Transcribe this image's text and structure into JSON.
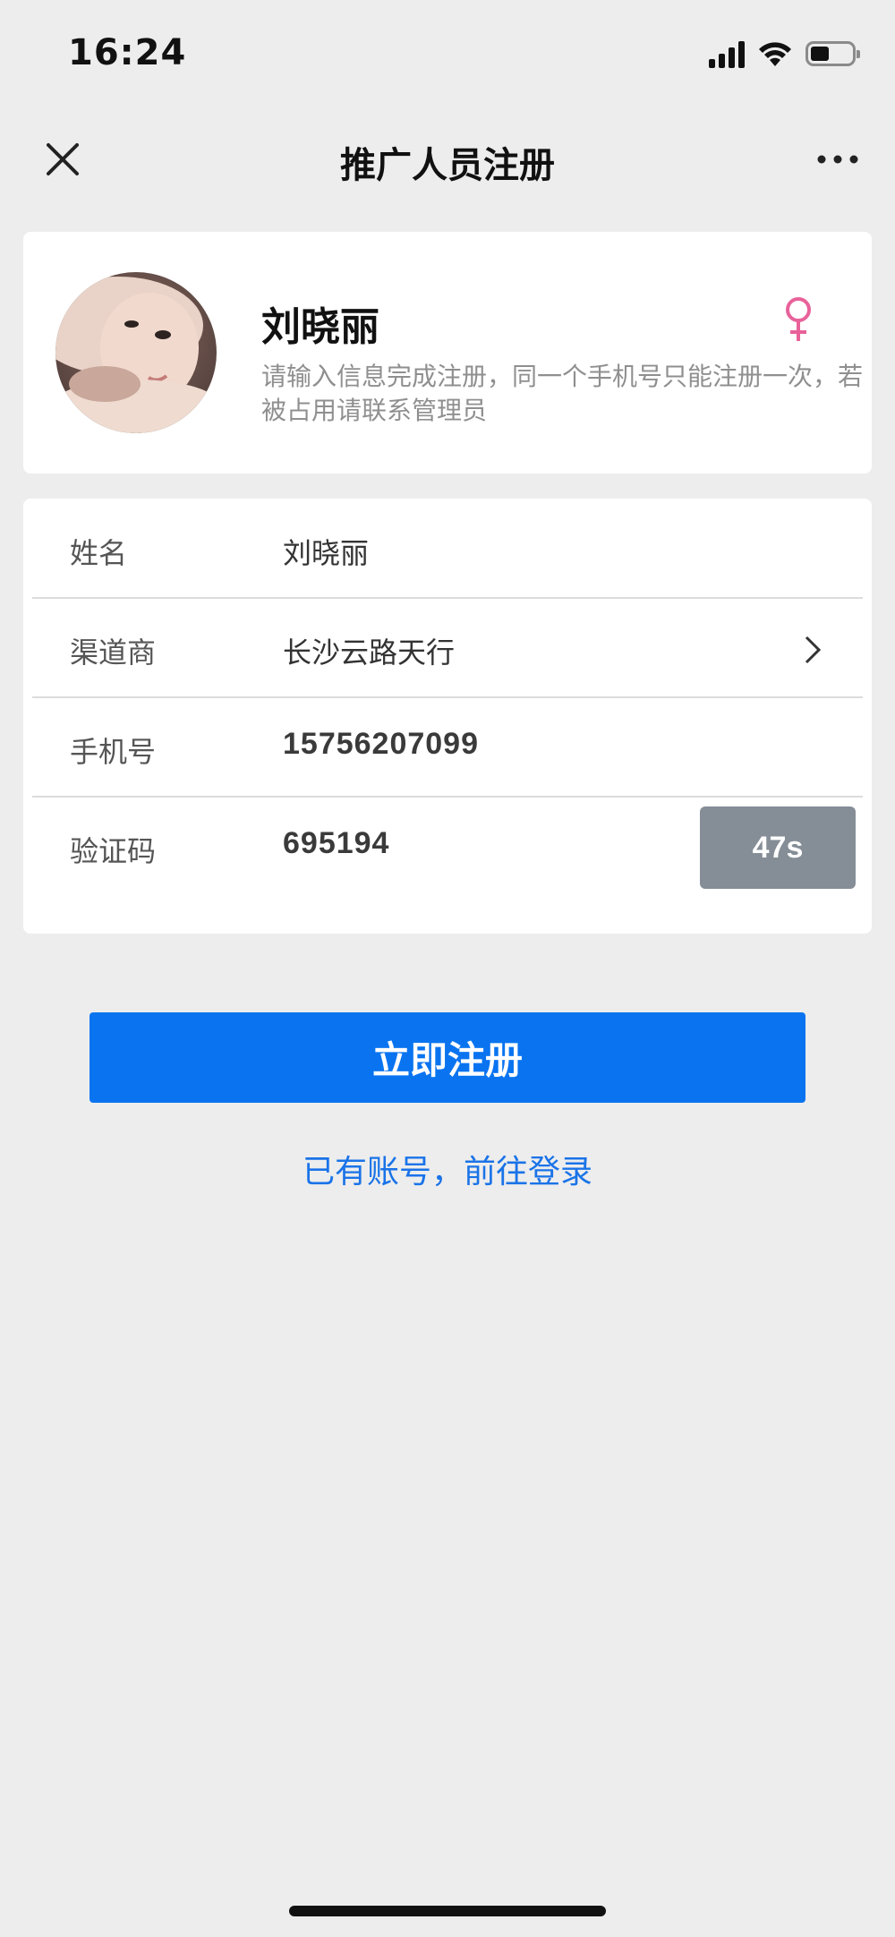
{
  "status_bar": {
    "time": "16:24",
    "battery_level": 0.45,
    "icons": [
      "cellular-signal-icon",
      "wifi-icon",
      "battery-icon"
    ]
  },
  "nav": {
    "title": "推广人员注册",
    "close_icon": "close-icon",
    "more_icon": "more-icon"
  },
  "profile": {
    "name": "刘晓丽",
    "description": "请输入信息完成注册，同一个手机号只能注册一次，若被占用请联系管理员",
    "gender_icon": "female-icon",
    "gender_color": "#E8629A"
  },
  "form": {
    "rows": [
      {
        "label": "姓名",
        "value": "刘晓丽"
      },
      {
        "label": "渠道商",
        "value": "长沙云路天行"
      },
      {
        "label": "手机号",
        "value": "15756207099"
      },
      {
        "label": "验证码",
        "value": "695194"
      }
    ],
    "code_button": "47s"
  },
  "actions": {
    "register_label": "立即注册",
    "login_link": "已有账号，前往登录"
  },
  "colors": {
    "primary": "#0A74F0",
    "link": "#1A73E8",
    "code_button_bg": "#858E97",
    "page_bg": "#EDEDED"
  }
}
